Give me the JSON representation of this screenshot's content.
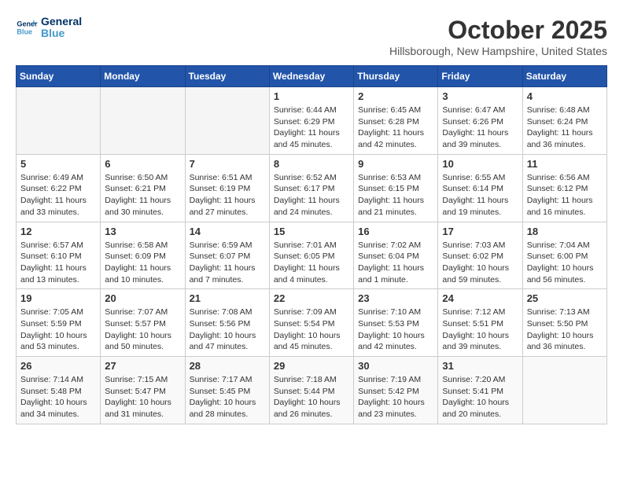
{
  "header": {
    "logo_general": "General",
    "logo_blue": "Blue",
    "month_title": "October 2025",
    "location": "Hillsborough, New Hampshire, United States"
  },
  "days_of_week": [
    "Sunday",
    "Monday",
    "Tuesday",
    "Wednesday",
    "Thursday",
    "Friday",
    "Saturday"
  ],
  "weeks": [
    [
      {
        "day": "",
        "empty": true
      },
      {
        "day": "",
        "empty": true
      },
      {
        "day": "",
        "empty": true
      },
      {
        "day": "1",
        "sunrise": "6:44 AM",
        "sunset": "6:29 PM",
        "daylight": "11 hours and 45 minutes."
      },
      {
        "day": "2",
        "sunrise": "6:45 AM",
        "sunset": "6:28 PM",
        "daylight": "11 hours and 42 minutes."
      },
      {
        "day": "3",
        "sunrise": "6:47 AM",
        "sunset": "6:26 PM",
        "daylight": "11 hours and 39 minutes."
      },
      {
        "day": "4",
        "sunrise": "6:48 AM",
        "sunset": "6:24 PM",
        "daylight": "11 hours and 36 minutes."
      }
    ],
    [
      {
        "day": "5",
        "sunrise": "6:49 AM",
        "sunset": "6:22 PM",
        "daylight": "11 hours and 33 minutes."
      },
      {
        "day": "6",
        "sunrise": "6:50 AM",
        "sunset": "6:21 PM",
        "daylight": "11 hours and 30 minutes."
      },
      {
        "day": "7",
        "sunrise": "6:51 AM",
        "sunset": "6:19 PM",
        "daylight": "11 hours and 27 minutes."
      },
      {
        "day": "8",
        "sunrise": "6:52 AM",
        "sunset": "6:17 PM",
        "daylight": "11 hours and 24 minutes."
      },
      {
        "day": "9",
        "sunrise": "6:53 AM",
        "sunset": "6:15 PM",
        "daylight": "11 hours and 21 minutes."
      },
      {
        "day": "10",
        "sunrise": "6:55 AM",
        "sunset": "6:14 PM",
        "daylight": "11 hours and 19 minutes."
      },
      {
        "day": "11",
        "sunrise": "6:56 AM",
        "sunset": "6:12 PM",
        "daylight": "11 hours and 16 minutes."
      }
    ],
    [
      {
        "day": "12",
        "sunrise": "6:57 AM",
        "sunset": "6:10 PM",
        "daylight": "11 hours and 13 minutes."
      },
      {
        "day": "13",
        "sunrise": "6:58 AM",
        "sunset": "6:09 PM",
        "daylight": "11 hours and 10 minutes."
      },
      {
        "day": "14",
        "sunrise": "6:59 AM",
        "sunset": "6:07 PM",
        "daylight": "11 hours and 7 minutes."
      },
      {
        "day": "15",
        "sunrise": "7:01 AM",
        "sunset": "6:05 PM",
        "daylight": "11 hours and 4 minutes."
      },
      {
        "day": "16",
        "sunrise": "7:02 AM",
        "sunset": "6:04 PM",
        "daylight": "11 hours and 1 minute."
      },
      {
        "day": "17",
        "sunrise": "7:03 AM",
        "sunset": "6:02 PM",
        "daylight": "10 hours and 59 minutes."
      },
      {
        "day": "18",
        "sunrise": "7:04 AM",
        "sunset": "6:00 PM",
        "daylight": "10 hours and 56 minutes."
      }
    ],
    [
      {
        "day": "19",
        "sunrise": "7:05 AM",
        "sunset": "5:59 PM",
        "daylight": "10 hours and 53 minutes."
      },
      {
        "day": "20",
        "sunrise": "7:07 AM",
        "sunset": "5:57 PM",
        "daylight": "10 hours and 50 minutes."
      },
      {
        "day": "21",
        "sunrise": "7:08 AM",
        "sunset": "5:56 PM",
        "daylight": "10 hours and 47 minutes."
      },
      {
        "day": "22",
        "sunrise": "7:09 AM",
        "sunset": "5:54 PM",
        "daylight": "10 hours and 45 minutes."
      },
      {
        "day": "23",
        "sunrise": "7:10 AM",
        "sunset": "5:53 PM",
        "daylight": "10 hours and 42 minutes."
      },
      {
        "day": "24",
        "sunrise": "7:12 AM",
        "sunset": "5:51 PM",
        "daylight": "10 hours and 39 minutes."
      },
      {
        "day": "25",
        "sunrise": "7:13 AM",
        "sunset": "5:50 PM",
        "daylight": "10 hours and 36 minutes."
      }
    ],
    [
      {
        "day": "26",
        "sunrise": "7:14 AM",
        "sunset": "5:48 PM",
        "daylight": "10 hours and 34 minutes."
      },
      {
        "day": "27",
        "sunrise": "7:15 AM",
        "sunset": "5:47 PM",
        "daylight": "10 hours and 31 minutes."
      },
      {
        "day": "28",
        "sunrise": "7:17 AM",
        "sunset": "5:45 PM",
        "daylight": "10 hours and 28 minutes."
      },
      {
        "day": "29",
        "sunrise": "7:18 AM",
        "sunset": "5:44 PM",
        "daylight": "10 hours and 26 minutes."
      },
      {
        "day": "30",
        "sunrise": "7:19 AM",
        "sunset": "5:42 PM",
        "daylight": "10 hours and 23 minutes."
      },
      {
        "day": "31",
        "sunrise": "7:20 AM",
        "sunset": "5:41 PM",
        "daylight": "10 hours and 20 minutes."
      },
      {
        "day": "",
        "empty": true
      }
    ]
  ]
}
